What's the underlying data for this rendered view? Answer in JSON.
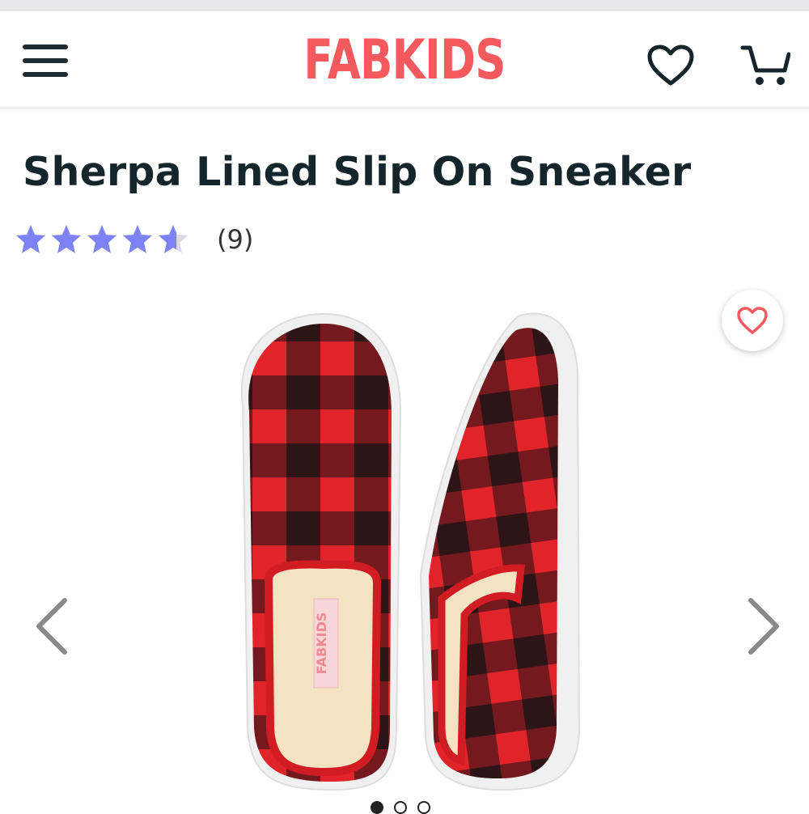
{
  "header": {
    "logo_text": "FABKIDS",
    "menu_icon": "hamburger-menu-icon",
    "wishlist_icon": "heart-outline-icon",
    "cart_icon": "shopping-cart-icon"
  },
  "product": {
    "title": "Sherpa Lined Slip On Sneaker",
    "rating": 4.5,
    "rating_max": 5,
    "review_count": "(9)",
    "image_label": "FABKIDS",
    "favorite_icon": "heart-outline-icon"
  },
  "gallery": {
    "prev_icon": "chevron-left-icon",
    "next_icon": "chevron-right-icon",
    "image_count": 3,
    "active_index": 0
  },
  "colors": {
    "brand": "#f4595d",
    "text": "#14252c",
    "star": "#7d82f6",
    "plaid_red": "#e0242a",
    "plaid_black": "#1b1314"
  }
}
